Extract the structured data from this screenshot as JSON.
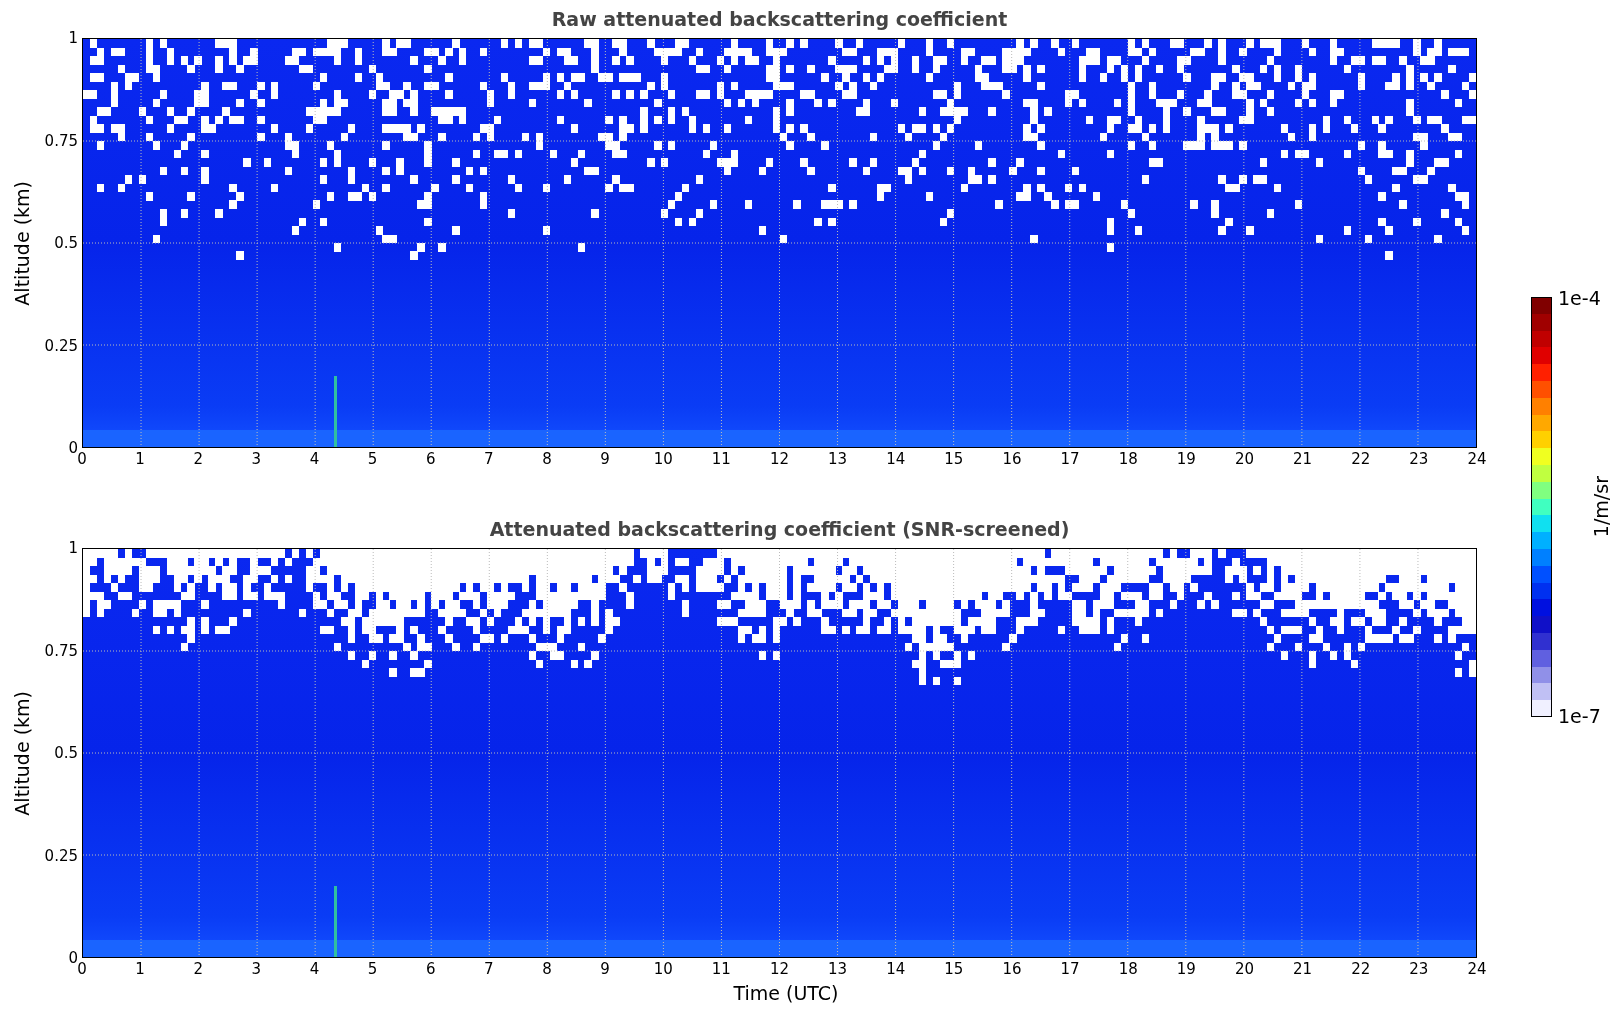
{
  "panels": [
    {
      "kind": "raw",
      "title": "Raw attenuated backscattering coefficient",
      "ylabel": "Altitude (km)",
      "yticks": [
        "1",
        "0.75",
        "0.5",
        "0.25",
        "0"
      ],
      "xticks": [
        "0",
        "1",
        "2",
        "3",
        "4",
        "5",
        "6",
        "7",
        "8",
        "9",
        "10",
        "11",
        "12",
        "13",
        "14",
        "15",
        "16",
        "17",
        "18",
        "19",
        "20",
        "21",
        "22",
        "23",
        "24"
      ]
    },
    {
      "kind": "screened",
      "title": "Attenuated backscattering coefficient (SNR-screened)",
      "ylabel": "Altitude (km)",
      "yticks": [
        "1",
        "0.75",
        "0.5",
        "0.25",
        "0"
      ],
      "xticks": [
        "0",
        "1",
        "2",
        "3",
        "4",
        "5",
        "6",
        "7",
        "8",
        "9",
        "10",
        "11",
        "12",
        "13",
        "14",
        "15",
        "16",
        "17",
        "18",
        "19",
        "20",
        "21",
        "22",
        "23",
        "24"
      ]
    }
  ],
  "xlabel": "Time (UTC)",
  "colorbar": {
    "max": "1e-4",
    "min": "1e-7",
    "label": "1/m/sr"
  }
}
